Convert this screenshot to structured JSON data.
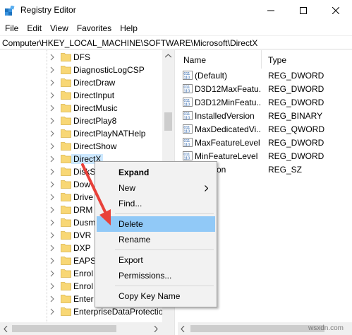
{
  "window": {
    "title": "Registry Editor",
    "icon": "registry-editor-icon",
    "controls": [
      "minimize-icon",
      "maximize-icon",
      "close-icon"
    ]
  },
  "menu": [
    "File",
    "Edit",
    "View",
    "Favorites",
    "Help"
  ],
  "address": "Computer\\HKEY_LOCAL_MACHINE\\SOFTWARE\\Microsoft\\DirectX",
  "tree": {
    "items": [
      {
        "label": "DFS"
      },
      {
        "label": "DiagnosticLogCSP"
      },
      {
        "label": "DirectDraw"
      },
      {
        "label": "DirectInput"
      },
      {
        "label": "DirectMusic"
      },
      {
        "label": "DirectPlay8"
      },
      {
        "label": "DirectPlayNATHelp"
      },
      {
        "label": "DirectShow"
      },
      {
        "label": "DirectX",
        "selected": true
      },
      {
        "label": "DiskS"
      },
      {
        "label": "Dow"
      },
      {
        "label": "Drive"
      },
      {
        "label": "DRM"
      },
      {
        "label": "Dusm"
      },
      {
        "label": "DVR"
      },
      {
        "label": "DXP"
      },
      {
        "label": "EAPS"
      },
      {
        "label": "Enrol"
      },
      {
        "label": "Enrol"
      },
      {
        "label": "Enter"
      },
      {
        "label": "EnterpriseDataProtectio"
      }
    ]
  },
  "values": {
    "columns": {
      "name": "Name",
      "type": "Type"
    },
    "rows": [
      {
        "name": "(Default)",
        "type": "REG_DWORD"
      },
      {
        "name": "D3D12MaxFeatu...",
        "type": "REG_DWORD"
      },
      {
        "name": "D3D12MinFeatu...",
        "type": "REG_DWORD"
      },
      {
        "name": "InstalledVersion",
        "type": "REG_BINARY"
      },
      {
        "name": "MaxDedicatedVi...",
        "type": "REG_QWORD"
      },
      {
        "name": "MaxFeatureLevel",
        "type": "REG_DWORD"
      },
      {
        "name": "MinFeatureLevel",
        "type": "REG_DWORD"
      },
      {
        "name": "on",
        "type": "REG_SZ"
      }
    ]
  },
  "context_menu": {
    "expand": "Expand",
    "new": "New",
    "find": "Find...",
    "delete": "Delete",
    "rename": "Rename",
    "export": "Export",
    "permissions": "Permissions...",
    "copy_key_name": "Copy Key Name"
  },
  "colors": {
    "folder": "#f8d775",
    "selection": "#cce8ff",
    "menu_hover": "#91c9f7",
    "arrow": "#e8413a"
  },
  "watermark": "wsxdn.com"
}
